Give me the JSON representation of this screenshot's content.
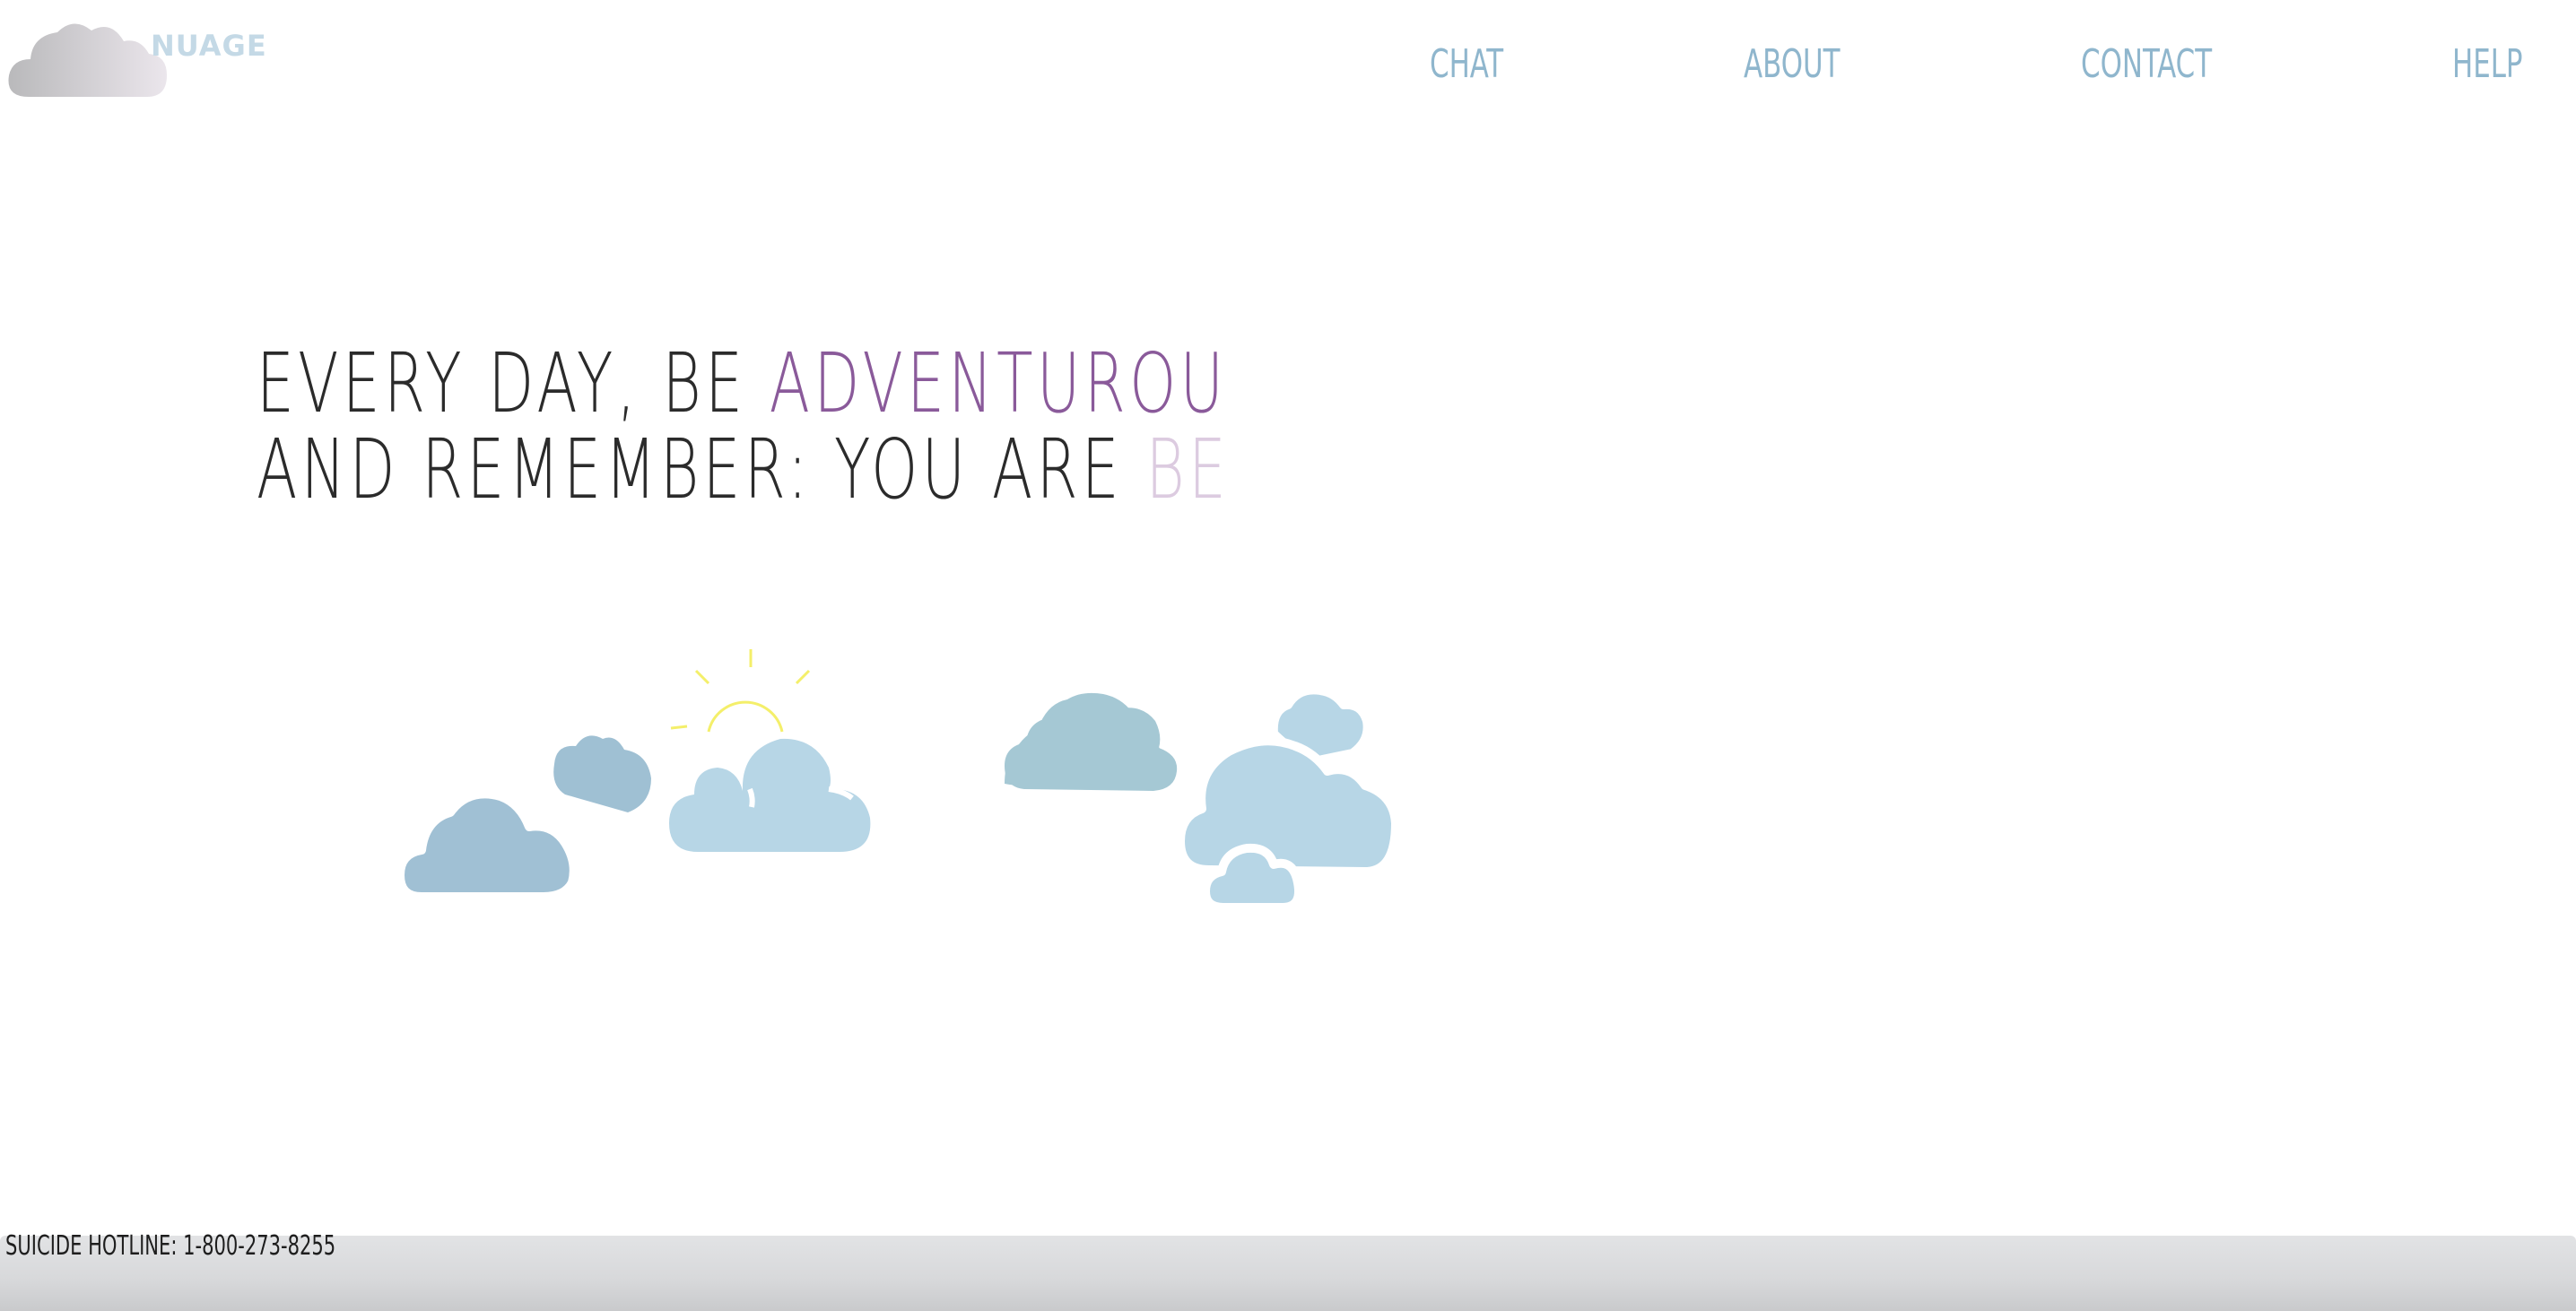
{
  "header": {
    "logo_text": "NUAGE",
    "nav": [
      {
        "label": "CHAT"
      },
      {
        "label": "ABOUT"
      },
      {
        "label": "CONTACT"
      },
      {
        "label": "HELP"
      }
    ]
  },
  "headline": {
    "line1_prefix": "EVERY  DAY, BE ",
    "line1_accent": "ADVENTUROUS",
    "line2_prefix": "AND  REMEMBER:  YOU  ARE ",
    "line2_accent": "BEAU"
  },
  "footer": {
    "hotline": "SUICIDE  HOTLINE:  1-800-273-8255"
  },
  "colors": {
    "nav_text": "#8fb6cd",
    "accent_purple": "#8a5a9a",
    "accent_faded": "#dccbe0",
    "cloud_dark": "#a5c8d4",
    "cloud_mid": "#a0c0d4",
    "cloud_light": "#b7d6e6",
    "sun": "#f4ef6a"
  }
}
